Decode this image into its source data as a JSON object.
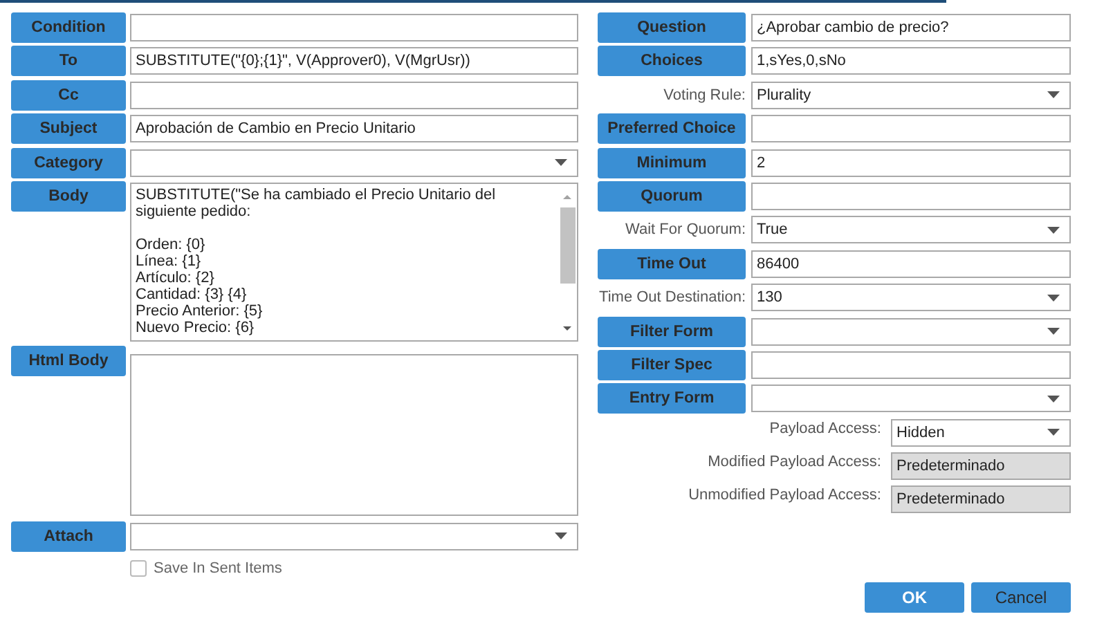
{
  "left_rows": [
    {
      "label": "Condition",
      "field": {
        "kind": "text"
      }
    },
    {
      "label": "To",
      "field": {
        "kind": "text",
        "value": "SUBSTITUTE(\"{0};{1}\", V(Approver0), V(MgrUsr))"
      }
    },
    {
      "label": "Cc",
      "field": {
        "kind": "text"
      }
    },
    {
      "label": "Subject",
      "field": {
        "kind": "text",
        "value": "Aprobación de Cambio en Precio Unitario"
      }
    },
    {
      "label": "Category",
      "field": {
        "kind": "select"
      }
    },
    {
      "label": "Body",
      "field": {
        "kind": "scrolltext",
        "value": "SUBSTITUTE(\"Se ha cambiado el Precio Unitario del siguiente pedido:\n\nOrden: {0}\nLínea: {1}\nArtículo: {2}\nCantidad: {3} {4}\nPrecio Anterior: {5}\nNuevo Precio: {6}"
      }
    },
    {
      "label": "Html Body",
      "field": {
        "kind": "textarea"
      }
    },
    {
      "label": "Attach",
      "field": {
        "kind": "select"
      }
    }
  ],
  "save_in_sent": {
    "label": "Save In Sent Items",
    "checked": false
  },
  "right_rows": [
    {
      "label": {
        "kind": "button",
        "text": "Question"
      },
      "field": {
        "kind": "text",
        "value": "¿Aprobar cambio de precio?"
      }
    },
    {
      "label": {
        "kind": "button",
        "text": "Choices"
      },
      "field": {
        "kind": "text",
        "value": "1,sYes,0,sNo"
      }
    },
    {
      "label": {
        "kind": "plain",
        "text": "Voting Rule:"
      },
      "field": {
        "kind": "select",
        "value": "Plurality"
      }
    },
    {
      "label": {
        "kind": "button",
        "text": "Preferred Choice"
      },
      "field": {
        "kind": "text"
      }
    },
    {
      "label": {
        "kind": "button",
        "text": "Minimum"
      },
      "field": {
        "kind": "text",
        "value": "2"
      }
    },
    {
      "label": {
        "kind": "button",
        "text": "Quorum"
      },
      "field": {
        "kind": "text"
      }
    },
    {
      "label": {
        "kind": "plain",
        "text": "Wait For Quorum:"
      },
      "field": {
        "kind": "select",
        "value": "True"
      }
    },
    {
      "label": {
        "kind": "button",
        "text": "Time Out"
      },
      "field": {
        "kind": "text",
        "value": "86400"
      }
    },
    {
      "label": {
        "kind": "plain",
        "text": "Time Out Destination:"
      },
      "field": {
        "kind": "select",
        "value": "130"
      }
    },
    {
      "label": {
        "kind": "button",
        "text": "Filter Form"
      },
      "field": {
        "kind": "select"
      }
    },
    {
      "label": {
        "kind": "button",
        "text": "Filter Spec"
      },
      "field": {
        "kind": "text"
      }
    },
    {
      "label": {
        "kind": "button",
        "text": "Entry Form"
      },
      "field": {
        "kind": "select"
      }
    }
  ],
  "payload_rows": [
    {
      "label": "Payload Access:",
      "field": {
        "kind": "select",
        "value": "Hidden"
      }
    },
    {
      "label": "Modified Payload Access:",
      "field": {
        "kind": "readonly",
        "value": "Predeterminado"
      }
    },
    {
      "label": "Unmodified Payload Access:",
      "field": {
        "kind": "readonly",
        "value": "Predeterminado"
      }
    }
  ],
  "buttons": [
    {
      "label": "OK",
      "kind": "primary"
    },
    {
      "label": "Cancel",
      "kind": "secondary"
    }
  ]
}
